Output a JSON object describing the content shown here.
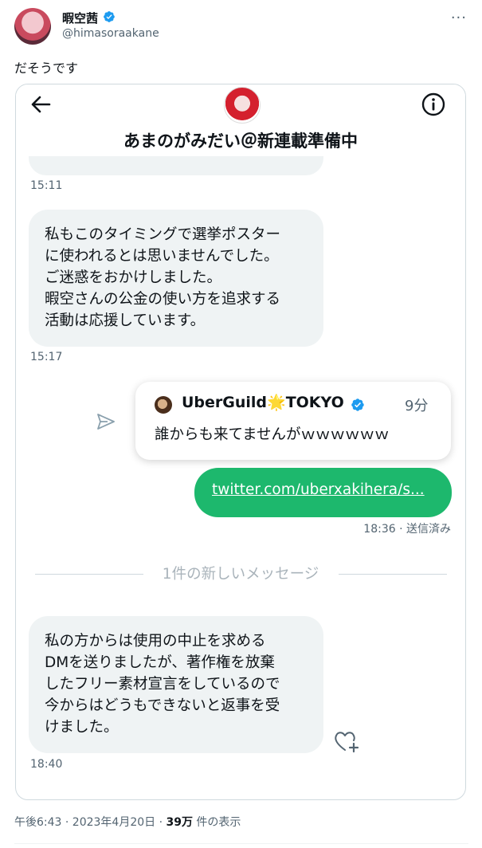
{
  "tweet": {
    "display_name": "暇空茜",
    "handle": "@himasoraakane",
    "text": "だそうです",
    "more": "···",
    "footer": {
      "time_date": "午後6:43 · 2023年4月20日 · ",
      "views_count": "39万",
      "views_label": " 件の表示"
    }
  },
  "dm": {
    "title": "あまのがみだい＠新連載準備中",
    "messages": [
      {
        "lines": [
          "私もこのタイミングで選挙ポスター",
          "に使われるとは思いませんでした。",
          "ご迷惑をおかけしました。",
          "暇空さんの公金の使い方を追求する",
          "活動は応援しています。"
        ],
        "time": "15:17"
      },
      {
        "lines": [
          "私の方からは使用の中止を求める",
          "DMを送りましたが、著作権を放棄",
          "したフリー素材宣言をしているので",
          "今からはどうもできないと返事を受",
          "けました。"
        ],
        "time": "18:40"
      }
    ],
    "first_time": "15:11",
    "quote": {
      "name": "UberGuild🌟TOKYO",
      "time": "9分",
      "text": "誰からも来てませんがｗｗｗｗｗｗ"
    },
    "sent": {
      "link": "twitter.com/uberxakihera/s...",
      "time": "18:36 · 送信済み"
    },
    "divider": "1件の新しいメッセージ"
  },
  "colors": {
    "accent_blue": "#1d9bf0",
    "sent_green": "#1db86d",
    "bubble_grey": "#eff3f4",
    "muted": "#536471"
  }
}
